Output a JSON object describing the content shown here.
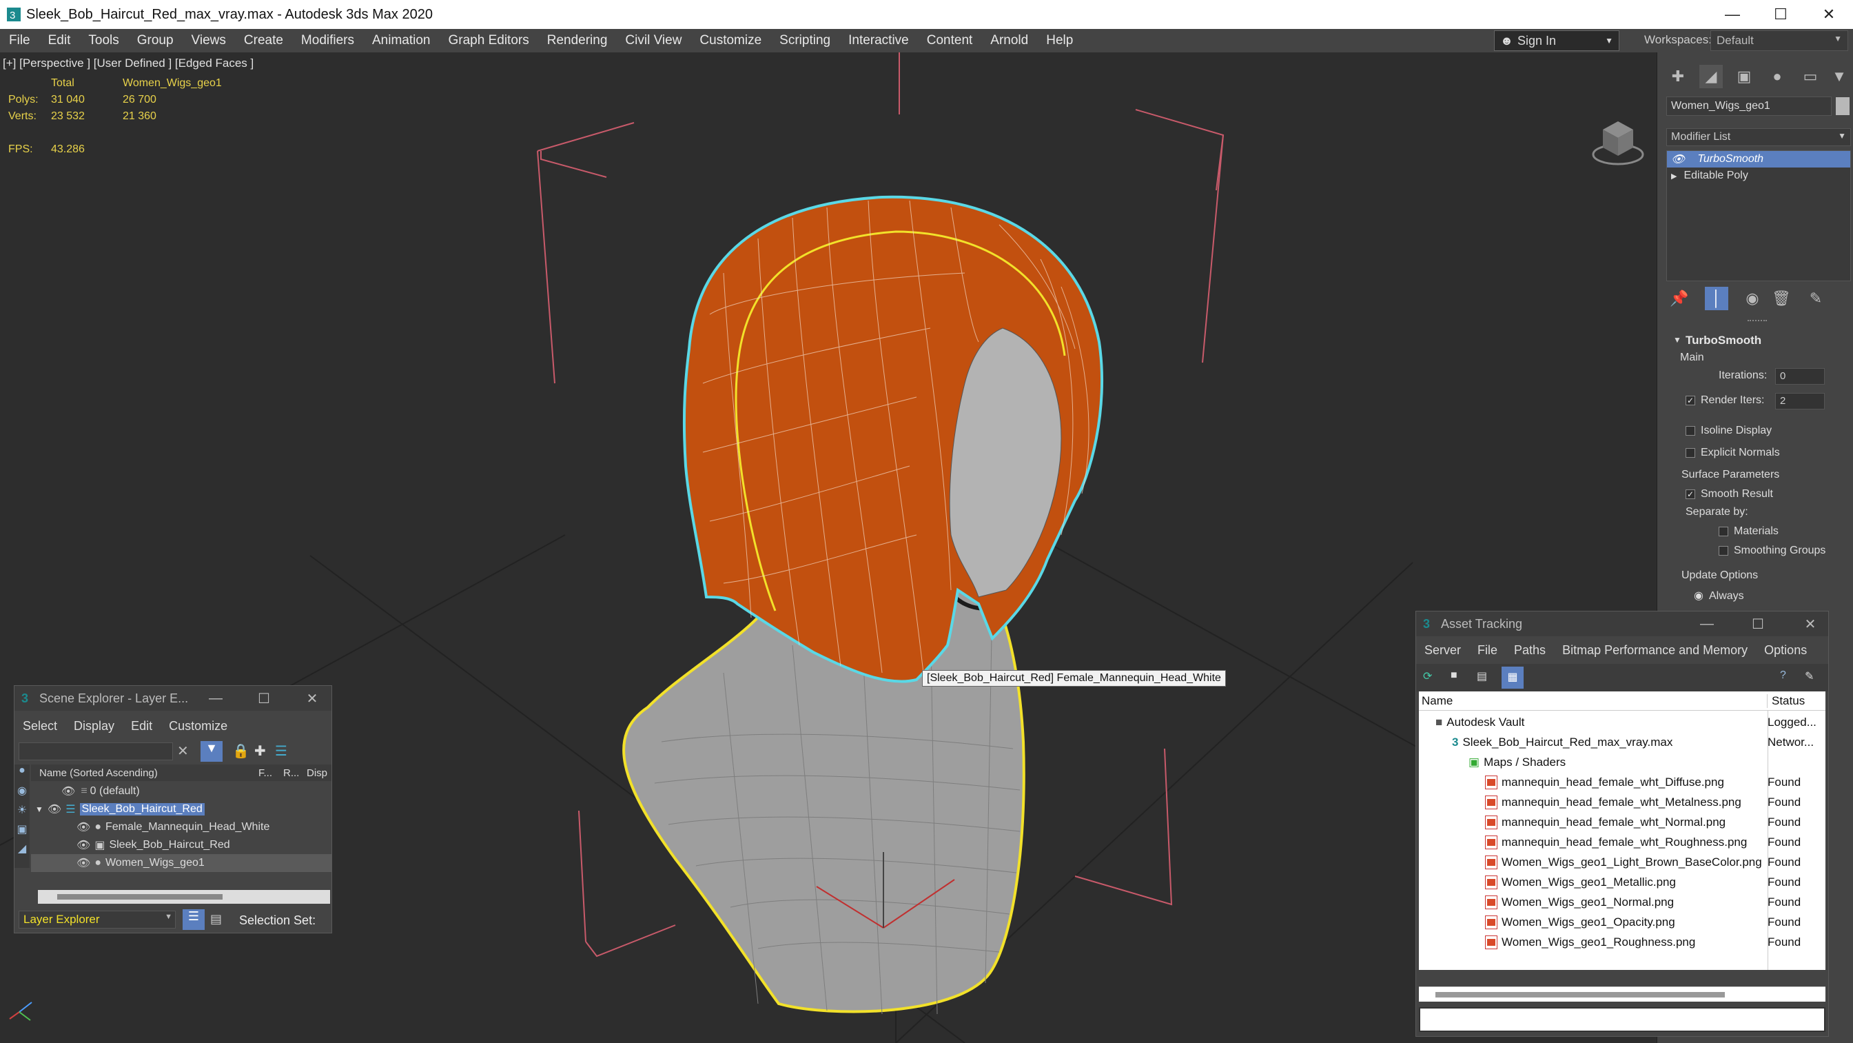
{
  "window": {
    "title": "Sleek_Bob_Haircut_Red_max_vray.max - Autodesk 3ds Max 2020",
    "minimize": "—",
    "maximize": "☐",
    "close": "✕"
  },
  "menu": [
    "File",
    "Edit",
    "Tools",
    "Group",
    "Views",
    "Create",
    "Modifiers",
    "Animation",
    "Graph Editors",
    "Rendering",
    "Civil View",
    "Customize",
    "Scripting",
    "Interactive",
    "Content",
    "Arnold",
    "Help"
  ],
  "signin": {
    "label": "Sign In"
  },
  "workspaces": {
    "label": "Workspaces:",
    "value": "Default"
  },
  "viewport": {
    "label": "[+] [Perspective ] [User Defined ] [Edged Faces ]",
    "stats": {
      "col_total": "Total",
      "col_object": "Women_Wigs_geo1",
      "polys_label": "Polys:",
      "polys_total": "31 040",
      "polys_object": "26 700",
      "verts_label": "Verts:",
      "verts_total": "23 532",
      "verts_object": "21 360",
      "fps_label": "FPS:",
      "fps_value": "43.286"
    },
    "tooltip": "[Sleek_Bob_Haircut_Red] Female_Mannequin_Head_White",
    "colors": {
      "hair": "#c2500f",
      "selection_outline": "#5ad8e6",
      "yellow_outline": "#f2e12a",
      "mannequin": "#a9a9a9",
      "grid": "#222222",
      "frame": "#c85a6a"
    }
  },
  "command_panel": {
    "object_name": "Women_Wigs_geo1",
    "modifier_list": "Modifier List",
    "stack": [
      {
        "label": "TurboSmooth",
        "selected": true
      },
      {
        "label": "Editable Poly",
        "selected": false
      }
    ],
    "turbosmooth": {
      "title": "TurboSmooth",
      "main": "Main",
      "iterations_label": "Iterations:",
      "iterations_value": "0",
      "render_iters_label": "Render Iters:",
      "render_iters_value": "2",
      "render_iters_checked": true,
      "isoline": "Isoline Display",
      "explicit_normals": "Explicit Normals",
      "surface_params": "Surface Parameters",
      "smooth_result": "Smooth Result",
      "separate_by": "Separate by:",
      "materials": "Materials",
      "smoothing_groups": "Smoothing Groups",
      "update_options": "Update Options",
      "always": "Always"
    }
  },
  "scene_explorer": {
    "title": "Scene Explorer - Layer E...",
    "menu": [
      "Select",
      "Display",
      "Edit",
      "Customize"
    ],
    "columns": {
      "name": "Name (Sorted Ascending)",
      "f": "F...",
      "r": "R...",
      "disp": "Disp"
    },
    "rows": [
      {
        "label": "0 (default)",
        "indent": 0,
        "type": "layer"
      },
      {
        "label": "Sleek_Bob_Haircut_Red",
        "indent": 0,
        "type": "layer-active"
      },
      {
        "label": "Female_Mannequin_Head_White",
        "indent": 1,
        "type": "object"
      },
      {
        "label": "Sleek_Bob_Haircut_Red",
        "indent": 1,
        "type": "group"
      },
      {
        "label": "Women_Wigs_geo1",
        "indent": 1,
        "type": "object-selected"
      }
    ],
    "footer_label": "Layer Explorer",
    "selection_set": "Selection Set:"
  },
  "asset_tracking": {
    "title": "Asset Tracking",
    "menu": [
      "Server",
      "File",
      "Paths",
      "Bitmap Performance and Memory",
      "Options"
    ],
    "columns": {
      "name": "Name",
      "status": "Status"
    },
    "rows": [
      {
        "name": "Autodesk Vault",
        "status": "Logged...",
        "indent": 0,
        "icon": "vault"
      },
      {
        "name": "Sleek_Bob_Haircut_Red_max_vray.max",
        "status": "Networ...",
        "indent": 1,
        "icon": "max"
      },
      {
        "name": "Maps / Shaders",
        "status": "",
        "indent": 2,
        "icon": "folder"
      },
      {
        "name": "mannequin_head_female_wht_Diffuse.png",
        "status": "Found",
        "indent": 3,
        "icon": "png"
      },
      {
        "name": "mannequin_head_female_wht_Metalness.png",
        "status": "Found",
        "indent": 3,
        "icon": "png"
      },
      {
        "name": "mannequin_head_female_wht_Normal.png",
        "status": "Found",
        "indent": 3,
        "icon": "png"
      },
      {
        "name": "mannequin_head_female_wht_Roughness.png",
        "status": "Found",
        "indent": 3,
        "icon": "png"
      },
      {
        "name": "Women_Wigs_geo1_Light_Brown_BaseColor.png",
        "status": "Found",
        "indent": 3,
        "icon": "png"
      },
      {
        "name": "Women_Wigs_geo1_Metallic.png",
        "status": "Found",
        "indent": 3,
        "icon": "png"
      },
      {
        "name": "Women_Wigs_geo1_Normal.png",
        "status": "Found",
        "indent": 3,
        "icon": "png"
      },
      {
        "name": "Women_Wigs_geo1_Opacity.png",
        "status": "Found",
        "indent": 3,
        "icon": "png"
      },
      {
        "name": "Women_Wigs_geo1_Roughness.png",
        "status": "Found",
        "indent": 3,
        "icon": "png"
      }
    ]
  }
}
